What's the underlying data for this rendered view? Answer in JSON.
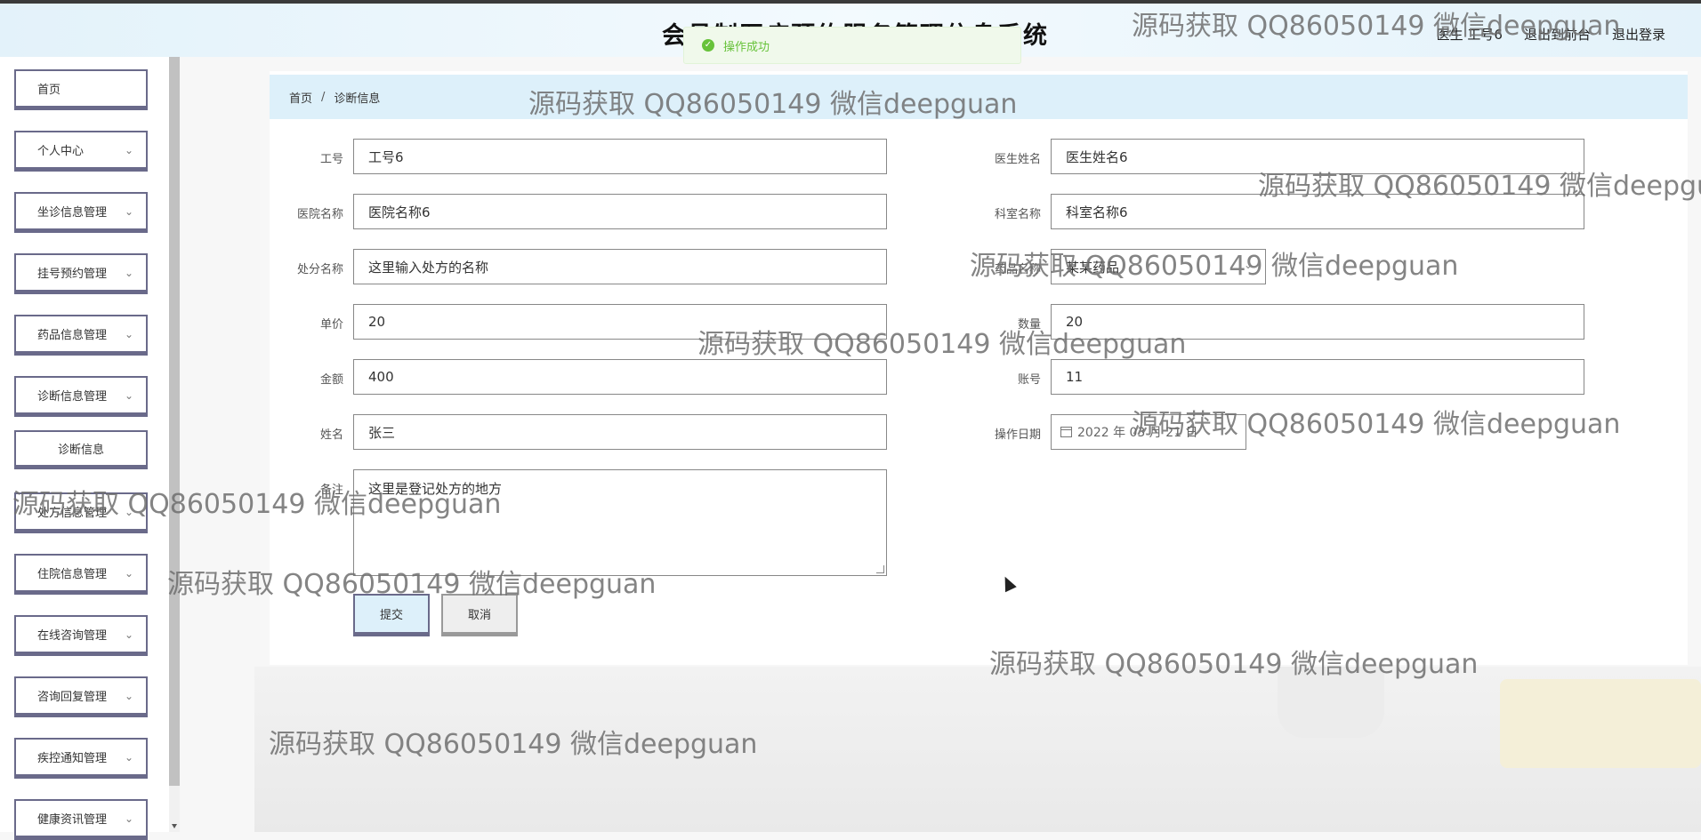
{
  "header": {
    "title": "会员制医疗预约服务管理信息系统",
    "links": [
      "医生 工号6",
      "退出到前台",
      "退出登录"
    ]
  },
  "toast": {
    "message": "操作成功"
  },
  "sidebar": {
    "items": [
      {
        "label": "首页"
      },
      {
        "label": "个人中心"
      },
      {
        "label": "坐诊信息管理"
      },
      {
        "label": "挂号预约管理"
      },
      {
        "label": "药品信息管理"
      },
      {
        "label": "诊断信息管理"
      },
      {
        "label": "诊断信息"
      },
      {
        "label": "处方信息管理"
      },
      {
        "label": "住院信息管理"
      },
      {
        "label": "在线咨询管理"
      },
      {
        "label": "咨询回复管理"
      },
      {
        "label": "疾控通知管理"
      },
      {
        "label": "健康资讯管理"
      }
    ]
  },
  "breadcrumb": {
    "home": "首页",
    "separator": "/",
    "current": "诊断信息"
  },
  "form": {
    "job_no": {
      "label": "工号",
      "value": "工号6"
    },
    "doctor_name": {
      "label": "医生姓名",
      "value": "医生姓名6"
    },
    "hospital": {
      "label": "医院名称",
      "value": "医院名称6"
    },
    "department": {
      "label": "科室名称",
      "value": "科室名称6"
    },
    "prescription": {
      "label": "处分名称",
      "value": "这里输入处方的名称"
    },
    "drug": {
      "label": "药品名称",
      "value": "某某药品"
    },
    "unit_price": {
      "label": "单价",
      "value": "20"
    },
    "quantity": {
      "label": "数量",
      "value": "20"
    },
    "amount": {
      "label": "金额",
      "value": "400"
    },
    "account": {
      "label": "账号",
      "value": "11"
    },
    "name": {
      "label": "姓名",
      "value": "张三"
    },
    "op_date": {
      "label": "操作日期",
      "value": "2022 年 03 月 21 日"
    },
    "remark": {
      "label": "备注",
      "value": "这里是登记处方的地方"
    },
    "submit_label": "提交",
    "cancel_label": "取消"
  },
  "watermark": {
    "text": "源码获取 QQ86050149 微信deepguan"
  },
  "colors": {
    "accent_bg": "#ddf0fa",
    "menu_border": "#6a6a8a",
    "toast_text": "#67c23a"
  }
}
